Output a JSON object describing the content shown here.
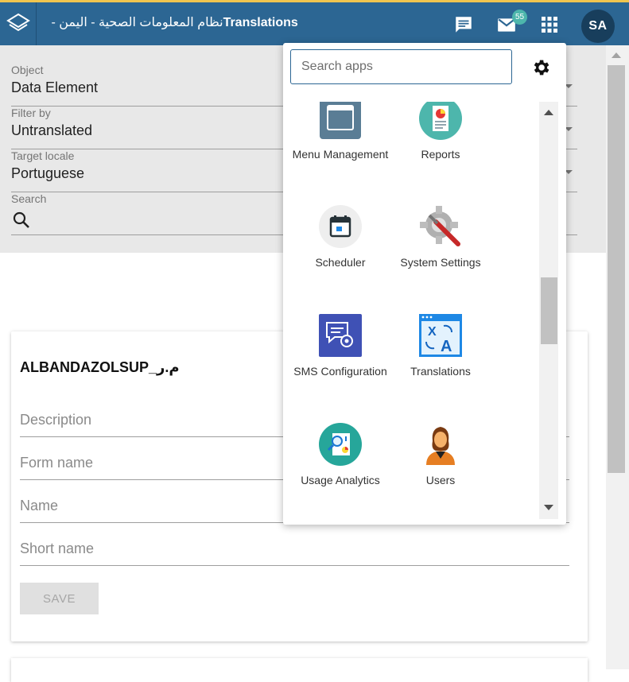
{
  "header": {
    "title_arabic": "نظام المعلومات الصحية - اليمن - ",
    "title_app": "Translations",
    "messages_icon": "chat-bubble-icon",
    "mail_icon": "mail-icon",
    "mail_count": "55",
    "apps_icon": "apps-grid-icon",
    "user_initials": "SA",
    "colors": {
      "bar": "#2c6693",
      "accent": "#f0c54f",
      "badge": "#4db6ac",
      "avatar": "#183e5c"
    }
  },
  "filters": {
    "object": {
      "label": "Object",
      "value": "Data Element"
    },
    "filter_by": {
      "label": "Filter by",
      "value": "Untranslated"
    },
    "target_locale": {
      "label": "Target locale",
      "value": "Portuguese"
    },
    "search": {
      "label": "Search",
      "icon": "search-icon"
    }
  },
  "card": {
    "title": "ALBANDAZOLSUP_م.ر",
    "fields": {
      "description": "Description",
      "form_name": "Form name",
      "name": "Name",
      "short_name": "Short name"
    },
    "save_label": "SAVE"
  },
  "apps_menu": {
    "search_placeholder": "Search apps",
    "settings_icon": "gear-icon",
    "apps": [
      {
        "label": "Menu Management",
        "icon": "window-icon"
      },
      {
        "label": "Reports",
        "icon": "report-chart-icon"
      },
      {
        "label": "Scheduler",
        "icon": "calendar-icon"
      },
      {
        "label": "System Settings",
        "icon": "settings-wrench-icon"
      },
      {
        "label": "SMS Configuration",
        "icon": "sms-gear-icon"
      },
      {
        "label": "Translations",
        "icon": "translate-icon"
      },
      {
        "label": "Usage Analytics",
        "icon": "analytics-icon"
      },
      {
        "label": "Users",
        "icon": "user-icon"
      }
    ]
  }
}
